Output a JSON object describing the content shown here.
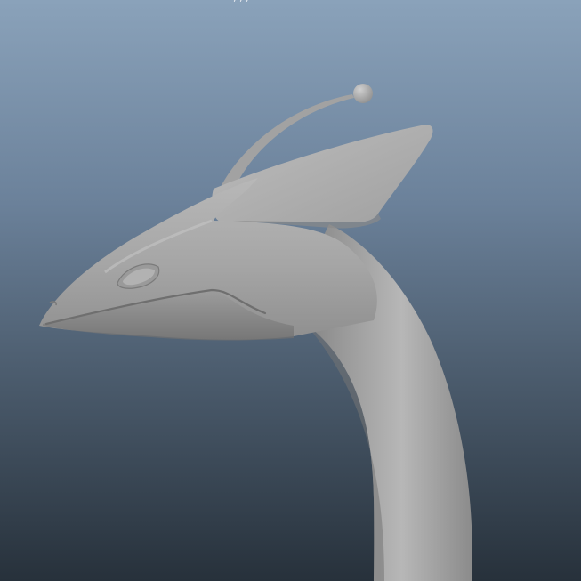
{
  "viewport": {
    "background_top": "#8aa2ba",
    "background_bottom": "#27313b",
    "model_color": "#a9a9a9",
    "hud_label": ",  ,  ,"
  },
  "model": {
    "icon": "creature-head-model"
  }
}
